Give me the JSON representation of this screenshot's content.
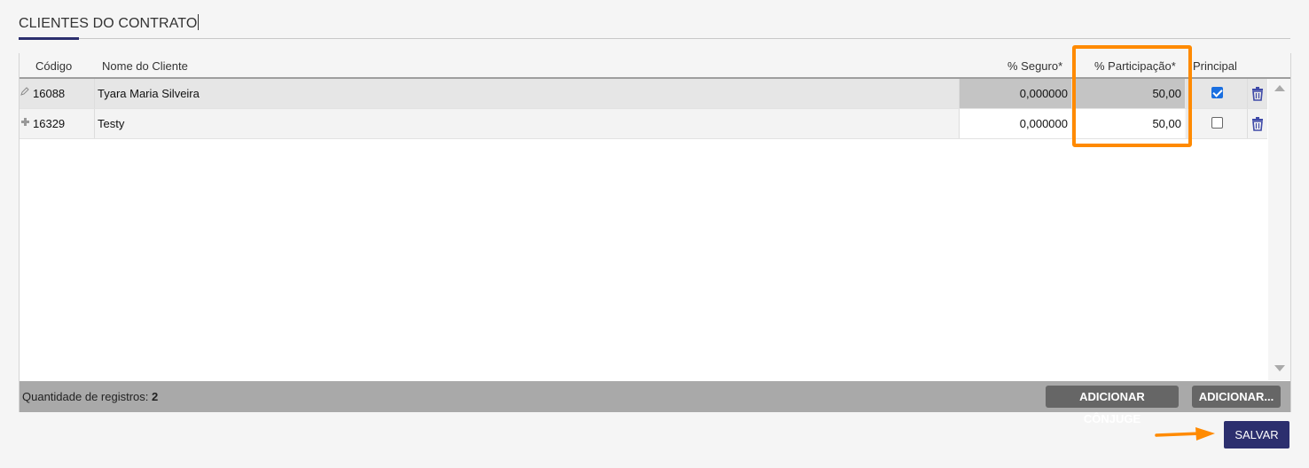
{
  "section": {
    "title": "CLIENTES DO CONTRATO"
  },
  "grid": {
    "columns": {
      "code": "Código",
      "name": "Nome do Cliente",
      "seguro": "% Seguro*",
      "participacao": "% Participação*",
      "principal": "Principal"
    },
    "rows": [
      {
        "code": "16088",
        "name": "Tyara Maria Silveira",
        "seguro": "0,000000",
        "participacao": "50,00",
        "principal": true,
        "marker": "pencil-icon"
      },
      {
        "code": "16329",
        "name": "Testy",
        "seguro": "0,000000",
        "participacao": "50,00",
        "principal": false,
        "marker": "plus-icon"
      }
    ]
  },
  "footer": {
    "records_label": "Quantidade de registros:",
    "records_count": "2",
    "add_spouse_button": "ADICIONAR CÔNJUGE",
    "add_button": "ADICIONAR..."
  },
  "actions": {
    "save_button": "SALVAR"
  },
  "colors": {
    "accent": "#2c2f6e",
    "highlight": "#ff8a00",
    "checkbox": "#1a6fe0",
    "trash": "#3f4aa8"
  }
}
